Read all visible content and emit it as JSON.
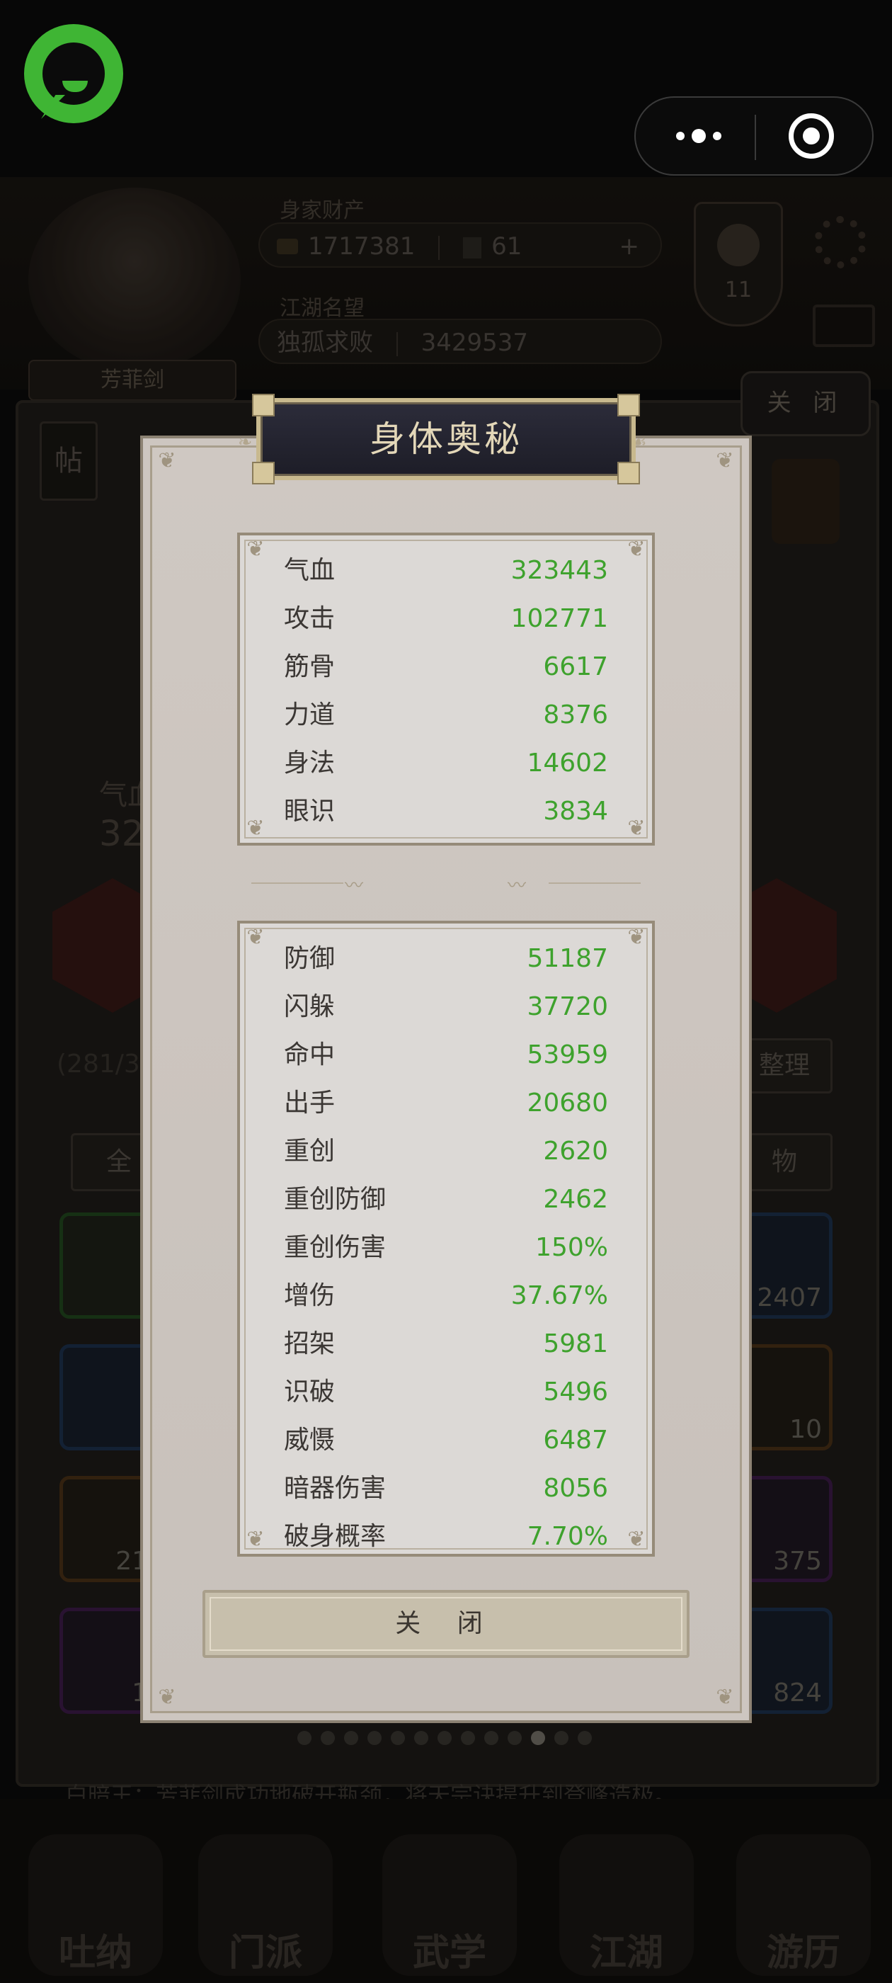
{
  "background": {
    "wealth_label": "身家财产",
    "silver": "1717381",
    "jade": "61",
    "plus": "+",
    "fame_label": "江湖名望",
    "fame_title": "独孤求败",
    "fame_value": "3429537",
    "shield_num": "11",
    "player_name": "芳菲剑",
    "close_label": "关 闭",
    "post_label": "帖",
    "hp_stub": "气血",
    "hp_stub_value": "32",
    "bag_count": "(281/3",
    "tidy_label": "整理",
    "tab_all": "全",
    "tab_item": "物",
    "tile_counts": [
      "2407",
      "10",
      "375",
      "824",
      "21",
      "1"
    ],
    "ticker": "白暗王：芳菲剑成功地破开瓶颈，将天宗诀提升到登峰造极。",
    "nav": [
      "吐纳",
      "门派",
      "武学",
      "江湖",
      "游历"
    ]
  },
  "modal": {
    "title": "身体奥秘",
    "primary_stats": [
      {
        "name": "气血",
        "value": "323443"
      },
      {
        "name": "攻击",
        "value": "102771"
      },
      {
        "name": "筋骨",
        "value": "6617"
      },
      {
        "name": "力道",
        "value": "8376"
      },
      {
        "name": "身法",
        "value": "14602"
      },
      {
        "name": "眼识",
        "value": "3834"
      }
    ],
    "secondary_stats": [
      {
        "name": "防御",
        "value": "51187"
      },
      {
        "name": "闪躲",
        "value": "37720"
      },
      {
        "name": "命中",
        "value": "53959"
      },
      {
        "name": "出手",
        "value": "20680"
      },
      {
        "name": "重创",
        "value": "2620"
      },
      {
        "name": "重创防御",
        "value": "2462"
      },
      {
        "name": "重创伤害",
        "value": "150%"
      },
      {
        "name": "增伤",
        "value": "37.67%"
      },
      {
        "name": "招架",
        "value": "5981"
      },
      {
        "name": "识破",
        "value": "5496"
      },
      {
        "name": "威慑",
        "value": "6487"
      },
      {
        "name": "暗器伤害",
        "value": "8056"
      },
      {
        "name": "破身概率",
        "value": "7.70%"
      }
    ],
    "close_button": "关 闭"
  },
  "colors": {
    "stat_value": "#3ea22d",
    "app_badge": "#3fb534",
    "title_text": "#e3d7b8"
  }
}
